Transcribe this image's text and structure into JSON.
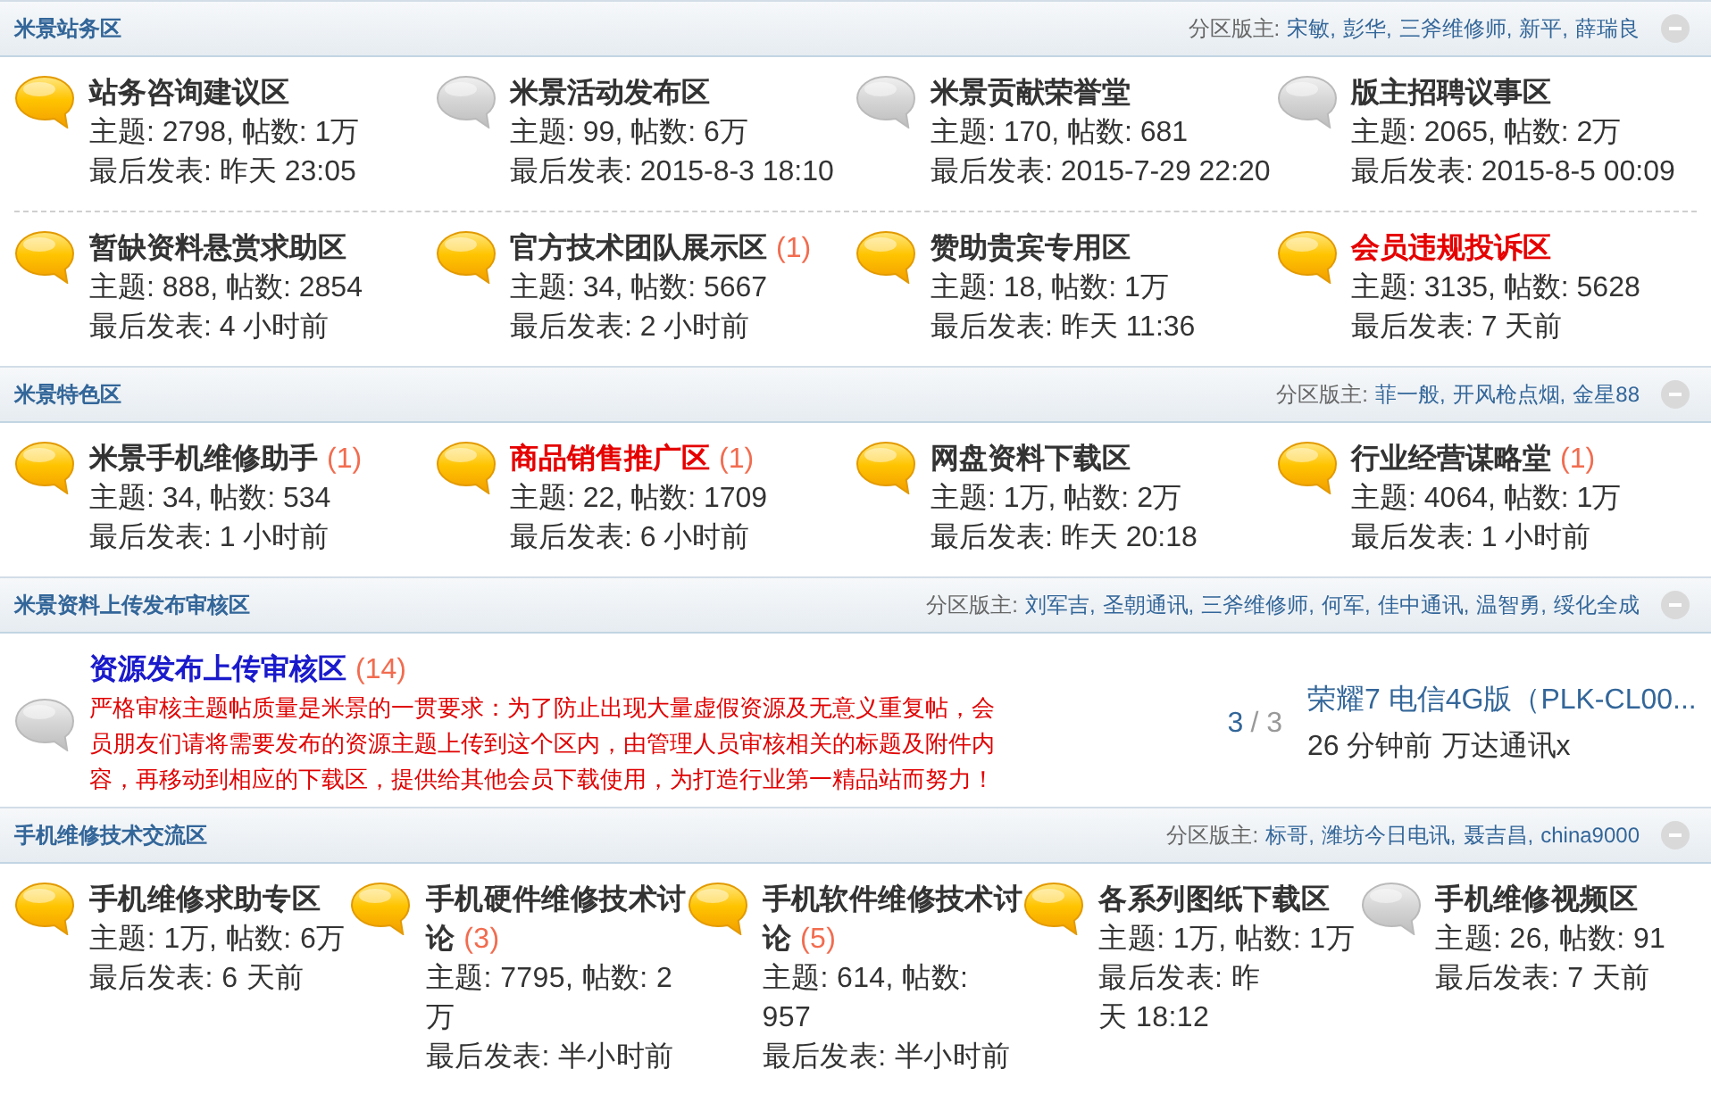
{
  "sections": [
    {
      "title": "米景站务区",
      "moderator_label": "分区版主:",
      "moderators": [
        "宋敏,",
        "彭华,",
        "三斧维修师,",
        "新平,",
        "薛瑞良"
      ],
      "expanded": true,
      "kind": "grid",
      "rows": [
        {
          "forums": [
            {
              "title": "站务咨询建议区",
              "color": "#333333",
              "new_posts": true,
              "stats": "主题: 2798, 帖数: 1万",
              "last_post": "最后发表: 昨天 23:05"
            },
            {
              "title": "米景活动发布区",
              "color": "#333333",
              "new_posts": false,
              "stats": "主题: 99, 帖数: 6万",
              "last_post": "最后发表: 2015-8-3 18:10"
            },
            {
              "title": "米景贡献荣誉堂",
              "color": "#333333",
              "new_posts": false,
              "stats": "主题: 170, 帖数: 681",
              "last_post": "最后发表: 2015-7-29 22:20"
            },
            {
              "title": "版主招聘议事区",
              "color": "#333333",
              "new_posts": false,
              "stats": "主题: 2065, 帖数: 2万",
              "last_post": "最后发表: 2015-8-5 00:09"
            }
          ]
        },
        {
          "forums": [
            {
              "title": "暂缺资料悬赏求助区",
              "color": "#333333",
              "new_posts": true,
              "stats": "主题: 888, 帖数: 2854",
              "last_post": "最后发表: 4 小时前"
            },
            {
              "title": "官方技术团队展示区",
              "color": "#333333",
              "new_count": "(1)",
              "new_posts": true,
              "stats": "主题: 34, 帖数: 5667",
              "last_post": "最后发表: 2 小时前"
            },
            {
              "title": "赞助贵宾专用区",
              "color": "#333333",
              "new_posts": true,
              "stats": "主题: 18, 帖数: 1万",
              "last_post": "最后发表: 昨天 11:36"
            },
            {
              "title": "会员违规投诉区",
              "color": "#e60000",
              "new_posts": true,
              "stats": "主题: 3135, 帖数: 5628",
              "last_post": "最后发表: 7 天前"
            }
          ]
        }
      ]
    },
    {
      "title": "米景特色区",
      "moderator_label": "分区版主:",
      "moderators": [
        "菲一般,",
        "开风枪点烟,",
        "金星88"
      ],
      "expanded": true,
      "kind": "grid",
      "rows": [
        {
          "forums": [
            {
              "title": "米景手机维修助手",
              "color": "#333333",
              "new_count": "(1)",
              "new_posts": true,
              "stats": "主题: 34, 帖数: 534",
              "last_post": "最后发表: 1 小时前"
            },
            {
              "title": "商品销售推广区",
              "color": "#e60000",
              "new_count": "(1)",
              "new_posts": true,
              "stats": "主题: 22, 帖数: 1709",
              "last_post": "最后发表: 6 小时前"
            },
            {
              "title": "网盘资料下载区",
              "color": "#333333",
              "new_posts": true,
              "stats": "主题: 1万, 帖数: 2万",
              "last_post": "最后发表: 昨天 20:18"
            },
            {
              "title": "行业经营谋略堂",
              "color": "#333333",
              "new_count": "(1)",
              "new_posts": true,
              "stats": "主题: 4064, 帖数: 1万",
              "last_post": "最后发表: 1 小时前"
            }
          ]
        }
      ]
    },
    {
      "title": "米景资料上传发布审核区",
      "moderator_label": "分区版主:",
      "moderators": [
        "刘军吉,",
        "圣朝通讯,",
        "三斧维修师,",
        "何军,",
        "佳中通讯,",
        "温智勇,",
        "绥化全成"
      ],
      "expanded": true,
      "kind": "list",
      "forums": [
        {
          "title": "资源发布上传审核区",
          "color": "#1a1acc",
          "new_count": "(14)",
          "new_posts": false,
          "description": "严格审核主题帖质量是米景的一贯要求：为了防止出现大量虚假资源及无意义重复帖，会员朋友们请将需要发布的资源主题上传到这个区内，由管理人员审核相关的标题及附件内容，再移动到相应的下载区，提供给其他会员下载使用，为打造行业第一精品站而努力！",
          "threads": "3",
          "posts": "/ 3",
          "latest": {
            "title": "荣耀7 电信4G版（PLK-CL00...",
            "time": "26 分钟前",
            "author": "万达通讯x"
          }
        }
      ]
    },
    {
      "title": "手机维修技术交流区",
      "moderator_label": "分区版主:",
      "moderators": [
        "标哥,",
        "潍坊今日电讯,",
        "聂吉昌,",
        "china9000"
      ],
      "expanded": true,
      "kind": "grid",
      "rows": [
        {
          "forums": [
            {
              "title": "手机维修求助专区",
              "color": "#333333",
              "new_posts": true,
              "stats": "主题: 1万, 帖数: 6万",
              "last_post": "最后发表: 6 天前"
            },
            {
              "title": "手机硬件维修技术讨论",
              "color": "#333333",
              "new_count": "(3)",
              "new_posts": true,
              "stats": "主题: 7795, 帖数: 2万",
              "last_post": "最后发表: 半小时前"
            },
            {
              "title": "手机软件维修技术讨论",
              "color": "#333333",
              "new_count": "(5)",
              "new_posts": true,
              "stats": "主题: 614, 帖数: 957",
              "last_post": "最后发表: 半小时前"
            },
            {
              "title": "各系列图纸下载区",
              "color": "#333333",
              "new_posts": true,
              "stats": "主题: 1万, 帖数: 1万",
              "last_post": "最后发表: 昨天 18:12"
            },
            {
              "title": "手机维修视频区",
              "color": "#333333",
              "new_posts": false,
              "stats": "主题: 26, 帖数: 91",
              "last_post": "最后发表: 7 天前"
            }
          ]
        }
      ]
    }
  ]
}
